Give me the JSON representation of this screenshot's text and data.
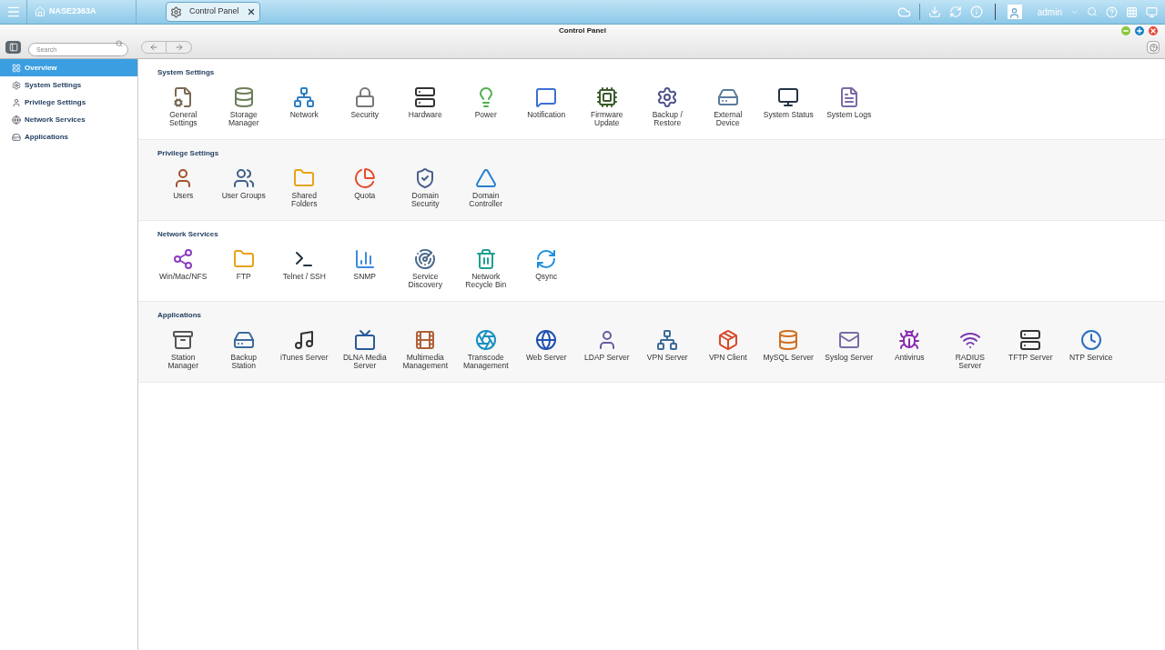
{
  "top_bar": {
    "device_name": "NASE2363A",
    "tabs": [
      {
        "label": "Control Panel",
        "selected": true
      }
    ],
    "user": "admin"
  },
  "window": {
    "title": "Control Panel"
  },
  "search": {
    "placeholder": "Search"
  },
  "sidebar": {
    "items": [
      {
        "label": "Overview",
        "selected": true
      },
      {
        "label": "System Settings",
        "selected": false
      },
      {
        "label": "Privilege Settings",
        "selected": false
      },
      {
        "label": "Network Services",
        "selected": false
      },
      {
        "label": "Applications",
        "selected": false
      }
    ]
  },
  "sections": [
    {
      "title": "System Settings",
      "items": [
        {
          "lines": [
            "General",
            "Settings"
          ]
        },
        {
          "lines": [
            "Storage",
            "Manager"
          ]
        },
        {
          "lines": [
            "Network"
          ]
        },
        {
          "lines": [
            "Security"
          ]
        },
        {
          "lines": [
            "Hardware"
          ]
        },
        {
          "lines": [
            "Power"
          ]
        },
        {
          "lines": [
            "Notification"
          ]
        },
        {
          "lines": [
            "Firmware",
            "Update"
          ]
        },
        {
          "lines": [
            "Backup /",
            "Restore"
          ]
        },
        {
          "lines": [
            "External",
            "Device"
          ]
        },
        {
          "lines": [
            "System Status"
          ]
        },
        {
          "lines": [
            "System Logs"
          ]
        }
      ]
    },
    {
      "title": "Privilege Settings",
      "items": [
        {
          "lines": [
            "Users"
          ]
        },
        {
          "lines": [
            "User Groups"
          ]
        },
        {
          "lines": [
            "Shared",
            "Folders"
          ]
        },
        {
          "lines": [
            "Quota"
          ]
        },
        {
          "lines": [
            "Domain",
            "Security"
          ]
        },
        {
          "lines": [
            "Domain",
            "Controller"
          ]
        }
      ]
    },
    {
      "title": "Network Services",
      "items": [
        {
          "lines": [
            "Win/Mac/NFS"
          ]
        },
        {
          "lines": [
            "FTP"
          ]
        },
        {
          "lines": [
            "Telnet / SSH"
          ]
        },
        {
          "lines": [
            "SNMP"
          ]
        },
        {
          "lines": [
            "Service",
            "Discovery"
          ]
        },
        {
          "lines": [
            "Network",
            "Recycle Bin"
          ]
        },
        {
          "lines": [
            "Qsync"
          ]
        }
      ]
    },
    {
      "title": "Applications",
      "items": [
        {
          "lines": [
            "Station",
            "Manager"
          ]
        },
        {
          "lines": [
            "Backup",
            "Station"
          ]
        },
        {
          "lines": [
            "iTunes Server"
          ]
        },
        {
          "lines": [
            "DLNA Media",
            "Server"
          ]
        },
        {
          "lines": [
            "Multimedia",
            "Management"
          ]
        },
        {
          "lines": [
            "Transcode",
            "Management"
          ]
        },
        {
          "lines": [
            "Web Server"
          ]
        },
        {
          "lines": [
            "LDAP Server"
          ]
        },
        {
          "lines": [
            "VPN Server"
          ]
        },
        {
          "lines": [
            "VPN Client"
          ]
        },
        {
          "lines": [
            "MySQL Server"
          ]
        },
        {
          "lines": [
            "Syslog Server"
          ]
        },
        {
          "lines": [
            "Antivirus"
          ]
        },
        {
          "lines": [
            "RADIUS",
            "Server"
          ]
        },
        {
          "lines": [
            "TFTP Server"
          ]
        },
        {
          "lines": [
            "NTP Service"
          ]
        }
      ]
    }
  ]
}
